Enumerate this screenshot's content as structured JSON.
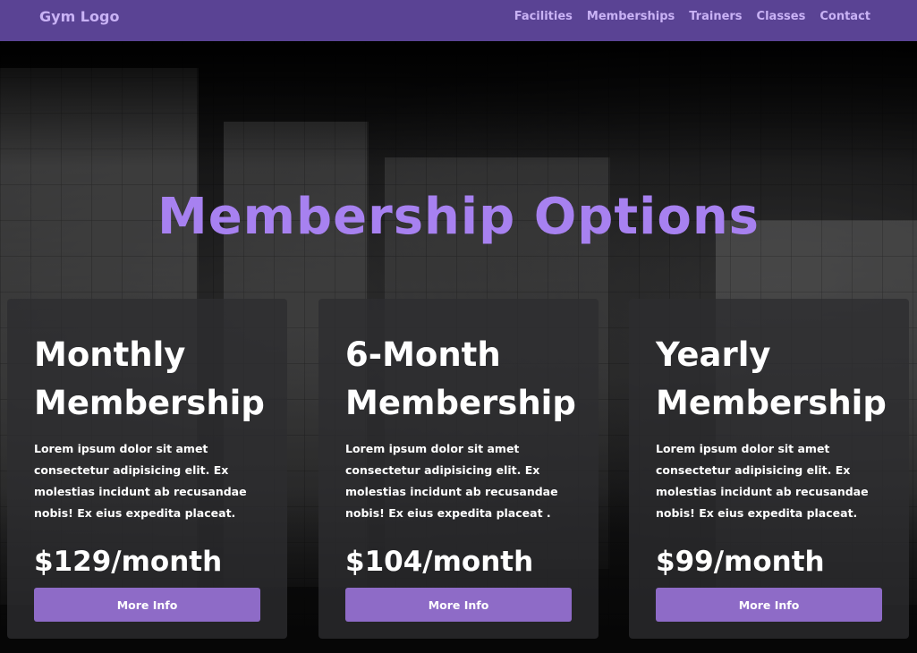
{
  "nav": {
    "logo": "Gym Logo",
    "links": [
      "Facilities",
      "Memberships",
      "Trainers",
      "Classes",
      "Contact"
    ]
  },
  "page": {
    "title": "Membership Options"
  },
  "cards": [
    {
      "title": "Monthly Membership",
      "description": "Lorem ipsum dolor sit amet consectetur adipisicing elit. Ex molestias incidunt ab recusandae nobis! Ex eius expedita placeat.",
      "price": "$129/month",
      "button": "More Info"
    },
    {
      "title": "6-Month Membership",
      "description": "Lorem ipsum dolor sit amet consectetur adipisicing elit. Ex molestias incidunt ab recusandae nobis! Ex eius expedita placeat .",
      "price": "$104/month",
      "button": "More Info"
    },
    {
      "title": "Yearly Membership",
      "description": "Lorem ipsum dolor sit amet consectetur adipisicing elit. Ex molestias incidunt ab recusandae nobis! Ex eius expedita placeat.",
      "price": "$99/month",
      "button": "More Info"
    }
  ],
  "colors": {
    "navbar": "#5a4394",
    "nav_text": "#c9b2f5",
    "title": "#a781f0",
    "button": "#8e6bc7"
  }
}
